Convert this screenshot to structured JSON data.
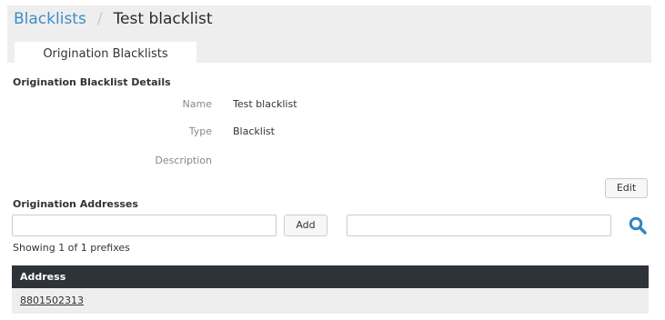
{
  "breadcrumb": {
    "parent": "Blacklists",
    "separator": "/",
    "current": "Test blacklist"
  },
  "tabs": [
    {
      "label": "Origination Blacklists",
      "active": true
    }
  ],
  "details": {
    "title": "Origination Blacklist Details",
    "fields": [
      {
        "label": "Name",
        "value": "Test blacklist"
      },
      {
        "label": "Type",
        "value": "Blacklist"
      },
      {
        "label": "Description",
        "value": ""
      }
    ],
    "edit_label": "Edit"
  },
  "addresses": {
    "title": "Origination Addresses",
    "add_input_value": "",
    "add_label": "Add",
    "search_input_value": "",
    "search_icon": "search-icon",
    "showing_text": "Showing 1 of 1 prefixes",
    "columns": [
      "Address"
    ],
    "rows": [
      {
        "address": "8801502313"
      }
    ]
  },
  "colors": {
    "link": "#3b8ec9",
    "header_band": "#eeeeee",
    "table_header": "#2e3339",
    "search_icon": "#2f86c3"
  }
}
